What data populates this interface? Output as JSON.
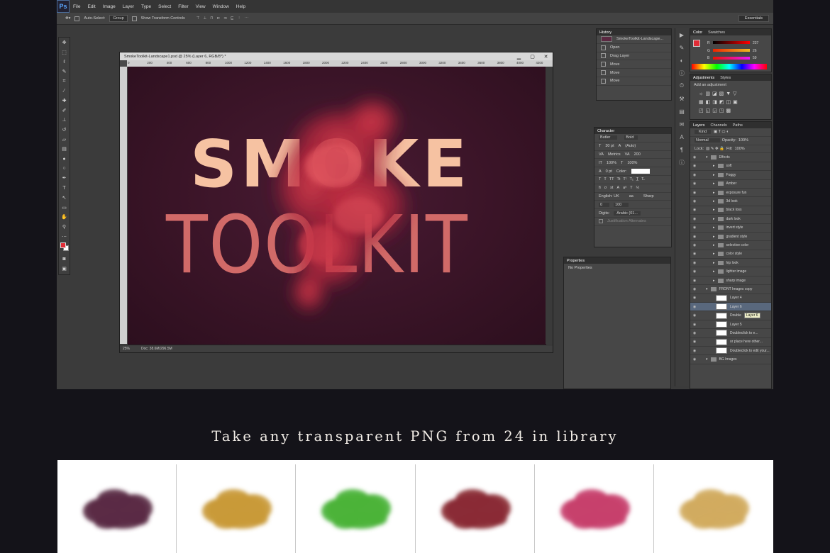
{
  "app": {
    "logo": "Ps"
  },
  "menu": [
    "File",
    "Edit",
    "Image",
    "Layer",
    "Type",
    "Select",
    "Filter",
    "View",
    "Window",
    "Help"
  ],
  "options_bar": {
    "auto_select": "Auto-Select:",
    "auto_select_value": "Group",
    "transform": "Show Transform Controls",
    "workspace": "Essentials"
  },
  "document": {
    "title": "SmokeToolkit-Landscape1.psd @ 25% (Layer 6, RGB/8*) *",
    "ruler_ticks": [
      "0",
      "200",
      "400",
      "600",
      "800",
      "1000",
      "1200",
      "1400",
      "1600",
      "1800",
      "2000",
      "2200",
      "2400",
      "2600",
      "2800",
      "3000",
      "3200",
      "3400",
      "3600",
      "3800",
      "4000",
      "4200"
    ],
    "zoom": "25%",
    "doc_size": "Doc: 38.6M/296.5M",
    "headline1": "SMOKE",
    "headline2": "TOOLKIT"
  },
  "history": {
    "title": "History",
    "snapshot": "SmokeToolkit-Landscape...",
    "items": [
      "Open",
      "Drag Layer",
      "Move",
      "Move",
      "Move"
    ]
  },
  "color": {
    "tabs": [
      "Color",
      "Swatches"
    ],
    "r": "237",
    "g": "26",
    "b": "59",
    "r_label": "R",
    "g_label": "G",
    "b_label": "B"
  },
  "adjustments": {
    "tabs": [
      "Adjustments",
      "Styles"
    ],
    "label": "Add an adjustment"
  },
  "character": {
    "title": "Character",
    "font": "Butler",
    "style": "Bold",
    "size": "30 pt",
    "leading": "(Auto)",
    "kerning": "Metrics",
    "tracking": "200",
    "vscale": "100%",
    "hscale": "100%",
    "baseline": "0 pt",
    "color_label": "Color:",
    "language": "English: UK",
    "antialias": "Sharp",
    "indent": "0",
    "indent2": "100",
    "digits_label": "Digits:",
    "digits": "Arabic (01...",
    "justification": "Justification Alternates"
  },
  "properties": {
    "title": "Properties",
    "content": "No Properties"
  },
  "layers_panel": {
    "tabs": [
      "Layers",
      "Channels",
      "Paths"
    ],
    "kind": "Kind",
    "blend": "Normal",
    "opacity_label": "Opacity:",
    "opacity": "100%",
    "lock_label": "Lock:",
    "fill_label": "Fill:",
    "fill": "100%",
    "layers": [
      {
        "name": "Effects",
        "type": "group"
      },
      {
        "name": "soft",
        "type": "folder"
      },
      {
        "name": "Foggy",
        "type": "folder"
      },
      {
        "name": "Amber",
        "type": "folder"
      },
      {
        "name": "exposure fun",
        "type": "folder"
      },
      {
        "name": "3d look",
        "type": "folder"
      },
      {
        "name": "black loss",
        "type": "folder"
      },
      {
        "name": "dark look",
        "type": "folder"
      },
      {
        "name": "invert style",
        "type": "folder"
      },
      {
        "name": "gradient style",
        "type": "folder"
      },
      {
        "name": "selective color",
        "type": "folder"
      },
      {
        "name": "color style",
        "type": "folder"
      },
      {
        "name": "hip look",
        "type": "folder"
      },
      {
        "name": "lighter image",
        "type": "folder"
      },
      {
        "name": "sharp image",
        "type": "folder"
      },
      {
        "name": "FRONT Images copy",
        "type": "group"
      },
      {
        "name": "Layer 4",
        "type": "thumb"
      },
      {
        "name": "Layer 6",
        "type": "thumb",
        "selected": true
      },
      {
        "name": "Double",
        "type": "thumb",
        "tooltip": "Layer 6"
      },
      {
        "name": "Layer 5",
        "type": "thumb"
      },
      {
        "name": "Doubleclick to e...",
        "type": "thumb"
      },
      {
        "name": "or place here other...",
        "type": "thumb"
      },
      {
        "name": "Doubleclick to edit your...",
        "type": "thumb"
      },
      {
        "name": "BG Images",
        "type": "group"
      }
    ]
  },
  "caption": "Take any transparent PNG from  24  in library",
  "library": [
    {
      "color": "#5a2a44"
    },
    {
      "color": "#c99a3a"
    },
    {
      "color": "#4bb33a"
    },
    {
      "color": "#8a2a35"
    },
    {
      "color": "#c7406c"
    },
    {
      "color": "#d1ab5e"
    }
  ]
}
